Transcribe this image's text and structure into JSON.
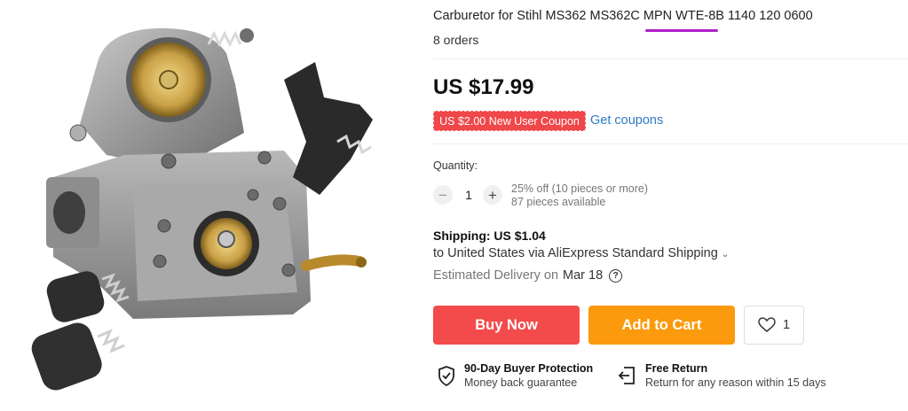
{
  "product": {
    "title": "Carburetor for Stihl MS362 MS362C MPN WTE-8B 1140 120 0600",
    "orders": "8 orders",
    "image_icon": "carburetor-image"
  },
  "price": {
    "current": "US $17.99"
  },
  "coupon": {
    "badge": "US $2.00 New User Coupon",
    "link": "Get coupons",
    "badge_color": "#f0474a",
    "link_color": "#2f7bc4"
  },
  "quantity": {
    "label": "Quantity:",
    "minus": "−",
    "value": "1",
    "plus": "+",
    "discount": "25% off (10 pieces or more)",
    "available": "87 pieces available"
  },
  "shipping": {
    "title": "Shipping: US $1.04",
    "detail": "to United States via AliExpress Standard Shipping",
    "chevron_icon": "chevron-down-icon",
    "delivery_label": "Estimated Delivery on",
    "delivery_date": "Mar 18",
    "help_icon": "question-circle-icon"
  },
  "actions": {
    "buy_now": "Buy Now",
    "add_to_cart": "Add to Cart",
    "wishlist_count": "1",
    "buy_color": "#f34b4b",
    "cart_color": "#fb9a0c"
  },
  "guarantees": {
    "protection_title": "90-Day Buyer Protection",
    "protection_sub": "Money back guarantee",
    "return_title": "Free Return",
    "return_sub": "Return for any reason within 15 days"
  }
}
